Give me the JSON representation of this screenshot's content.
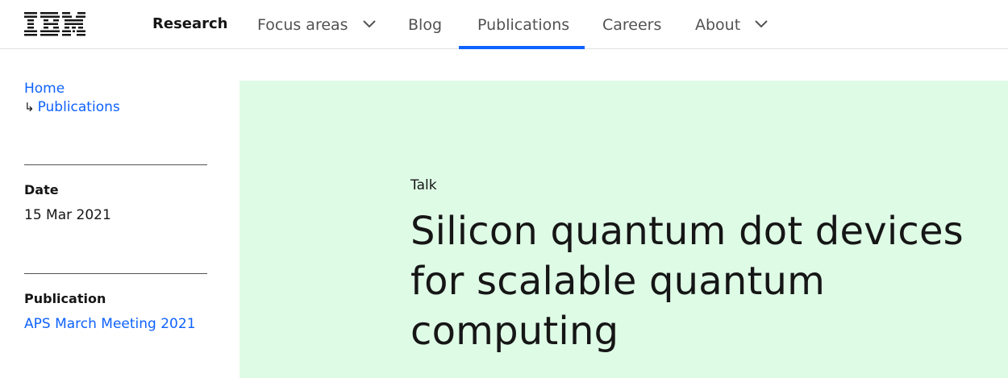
{
  "header": {
    "logo_text": "IBM",
    "brand": "Research",
    "nav": [
      {
        "label": "Focus areas",
        "has_dropdown": true,
        "active": false
      },
      {
        "label": "Blog",
        "has_dropdown": false,
        "active": false
      },
      {
        "label": "Publications",
        "has_dropdown": false,
        "active": true
      },
      {
        "label": "Careers",
        "has_dropdown": false,
        "active": false
      },
      {
        "label": "About",
        "has_dropdown": true,
        "active": false
      }
    ]
  },
  "breadcrumb": {
    "home": "Home",
    "arrow": "↳",
    "current": "Publications"
  },
  "meta": {
    "date_label": "Date",
    "date_value": "15 Mar 2021",
    "publication_label": "Publication",
    "publication_value": "APS March Meeting 2021"
  },
  "hero": {
    "content_type": "Talk",
    "title": "Silicon quantum dot devices for scalable quantum computing"
  },
  "colors": {
    "accent": "#0f62fe",
    "hero_background": "#defbe6",
    "text": "#161616",
    "nav_text": "#525252"
  }
}
